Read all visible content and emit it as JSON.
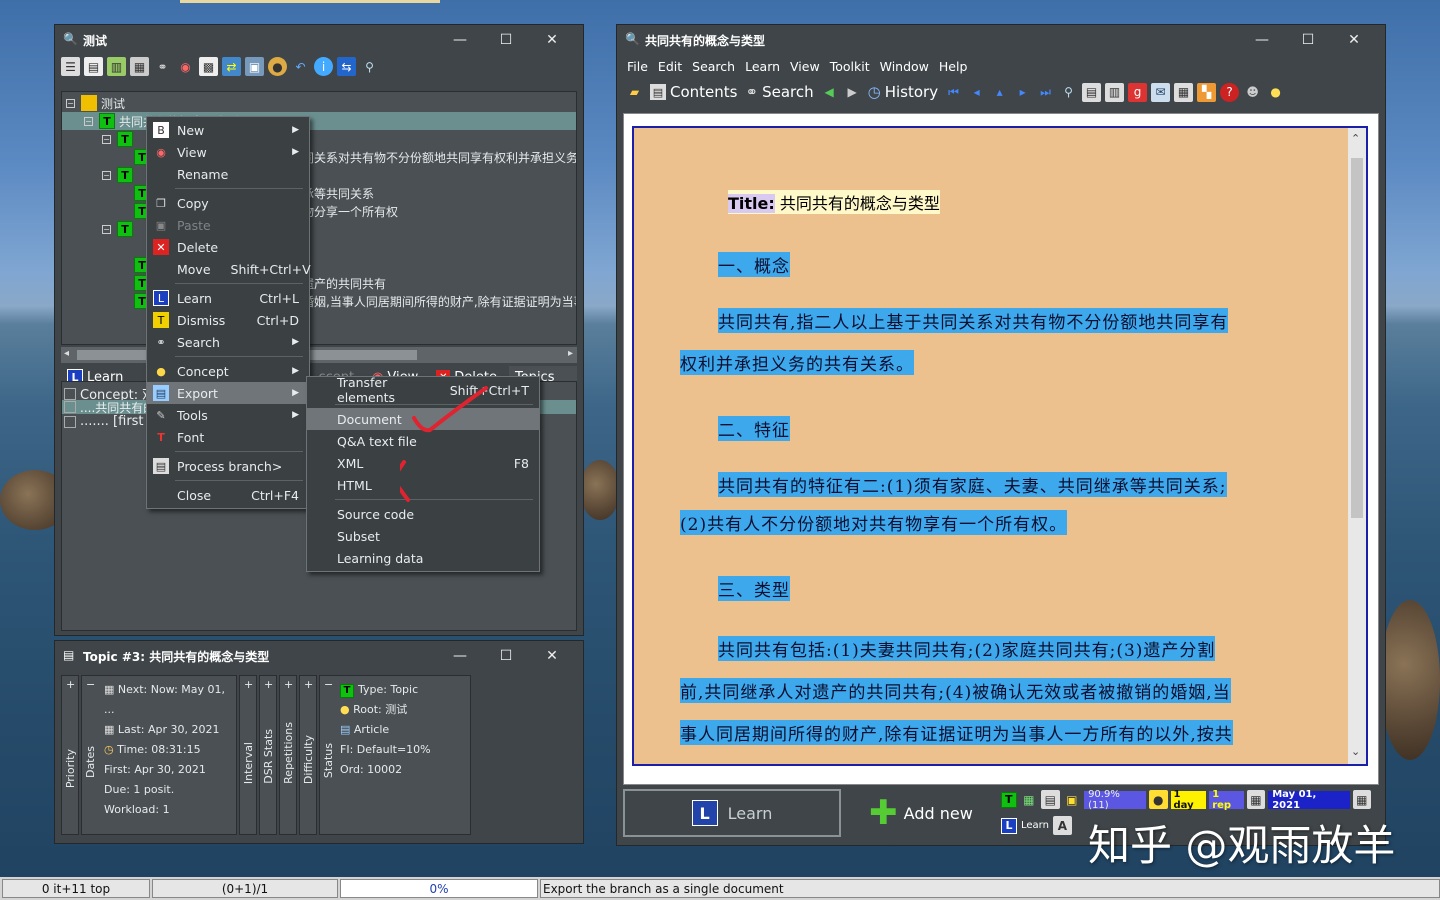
{
  "left_window": {
    "title": "测试",
    "controls": [
      "—",
      "☐",
      "✕"
    ],
    "tree": {
      "root": "测试",
      "selected": "共同共有的概念与类型 (10)",
      "row_texts": [
        "同关系对共有物不分份额地共同享有权利并承担义务",
        "承等共同关系",
        "物分享一个所有权",
        "遗产的共同共有",
        "婚姻,当事人同居期间所得的财产,除有证据证明为当事"
      ]
    },
    "learnbar": {
      "learn": "Learn",
      "accept": "ccept",
      "view": "View",
      "delete": "Delete",
      "topics": "Topics"
    },
    "concept_rows": [
      "Concept: 观",
      "....共同共有的",
      "....... [first"
    ]
  },
  "context_menu": {
    "items": [
      {
        "label": "New",
        "shortcut": "",
        "submenu": true,
        "icon": "new-icon"
      },
      {
        "label": "View",
        "shortcut": "",
        "submenu": true,
        "icon": "eye-icon"
      },
      {
        "label": "Rename",
        "shortcut": "",
        "submenu": false,
        "icon": ""
      },
      {
        "label": "Copy",
        "shortcut": "",
        "submenu": false,
        "icon": "copy-icon"
      },
      {
        "label": "Paste",
        "shortcut": "",
        "submenu": false,
        "icon": "paste-icon"
      },
      {
        "label": "Delete",
        "shortcut": "",
        "submenu": false,
        "icon": "delete-icon"
      },
      {
        "label": "Move",
        "shortcut": "Shift+Ctrl+V",
        "submenu": false,
        "icon": ""
      },
      {
        "label": "Learn",
        "shortcut": "Ctrl+L",
        "submenu": false,
        "icon": "learn-icon"
      },
      {
        "label": "Dismiss",
        "shortcut": "Ctrl+D",
        "submenu": false,
        "icon": "dismiss-icon"
      },
      {
        "label": "Search",
        "shortcut": "",
        "submenu": true,
        "icon": "binoculars-icon"
      },
      {
        "label": "Concept",
        "shortcut": "",
        "submenu": true,
        "icon": "bulb-icon"
      },
      {
        "label": "Export",
        "shortcut": "",
        "submenu": true,
        "icon": "export-icon"
      },
      {
        "label": "Tools",
        "shortcut": "",
        "submenu": true,
        "icon": "tools-icon"
      },
      {
        "label": "Font",
        "shortcut": "",
        "submenu": false,
        "icon": "font-icon"
      },
      {
        "label": "Process branch>",
        "shortcut": "",
        "submenu": false,
        "icon": "process-icon"
      },
      {
        "label": "Close",
        "shortcut": "Ctrl+F4",
        "submenu": false,
        "icon": ""
      }
    ]
  },
  "export_submenu": {
    "items": [
      {
        "label": "Transfer elements",
        "shortcut": "Shift+Ctrl+T"
      },
      {
        "label": "Document",
        "shortcut": ""
      },
      {
        "label": "Q&A text file",
        "shortcut": ""
      },
      {
        "label": "XML",
        "shortcut": "F8"
      },
      {
        "label": "HTML",
        "shortcut": ""
      },
      {
        "label": "Source code",
        "shortcut": ""
      },
      {
        "label": "Subset",
        "shortcut": ""
      },
      {
        "label": "Learning data",
        "shortcut": ""
      }
    ]
  },
  "topic_window": {
    "title": "Topic #3: 共同共有的概念与类型",
    "col1_labels": [
      "Priority",
      "Dates"
    ],
    "dates": [
      "Next: Now: May 01, ...",
      "Last: Apr 30, 2021",
      "Time: 08:31:15",
      "First: Apr 30, 2021",
      "Due: 1 posit.",
      "Workload: 1"
    ],
    "col2_labels": [
      "Interval",
      "DSR Stats",
      "Repetitions",
      "Difficulty",
      "Status"
    ],
    "info": [
      "Type: Topic",
      "Root: 测试",
      "Article",
      "FI: Default=10%",
      "Ord: 10002"
    ]
  },
  "right_window": {
    "title": "共同共有的概念与类型",
    "menus": [
      "File",
      "Edit",
      "Search",
      "Learn",
      "View",
      "Toolkit",
      "Window",
      "Help"
    ],
    "nav": {
      "contents": "Contents",
      "search": "Search",
      "history": "History"
    },
    "content": {
      "title_label": "Title:",
      "title_value": "共同共有的概念与类型",
      "h1": "一、概念",
      "p1a": "共同共有,指二人以上基于共同关系对共有物不分份额地共同享有",
      "p1b": "权利并承担义务的共有关系。",
      "h2": "二、特征",
      "p2a": "共同共有的特征有二:(1)须有家庭、夫妻、共同继承等共同关系;",
      "p2b": "(2)共有人不分份额地对共有物享有一个所有权。",
      "h3": "三、类型",
      "p3a": "共同共有包括:(1)夫妻共同共有;(2)家庭共同共有;(3)遗产分割",
      "p3b": "前,共同继承人对遗产的共同共有;(4)被确认无效或者被撤销的婚姻,当",
      "p3c": "事人同居期间所得的财产,除有证据证明为当事人一方所有的以外,按共"
    },
    "bottom": {
      "learn": "Learn",
      "add_new": "Add new",
      "stat_pct": "90.9% (11)",
      "day": "1 day",
      "rep": "1 rep",
      "date": "May 01, 2021",
      "learn_small": "Learn"
    }
  },
  "statusbar": {
    "s1": "0 it+11 top",
    "s2": "(0+1)/1",
    "s3": "0%",
    "s4": "Export the branch as a single document"
  },
  "watermark": "知乎 @观雨放羊"
}
